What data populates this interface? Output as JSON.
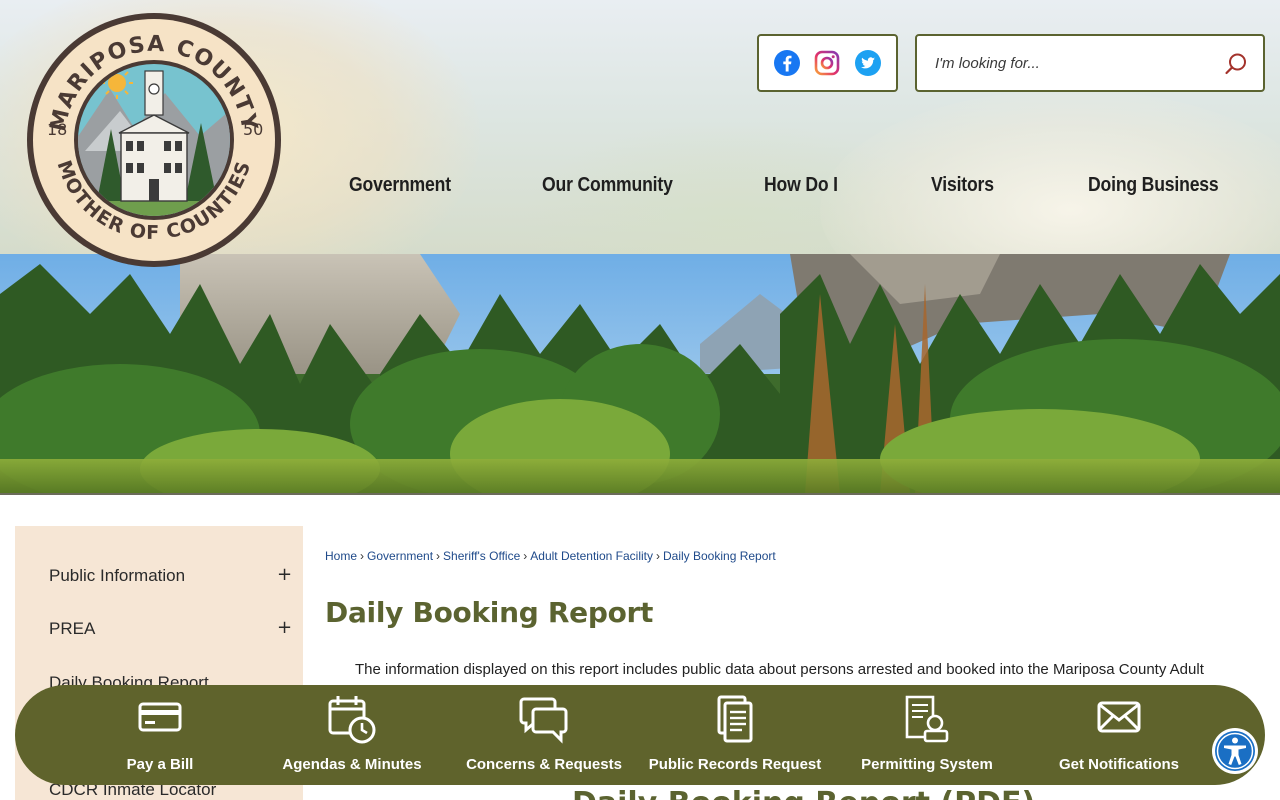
{
  "logo": {
    "text_top": "MARIPOSA COUNTY",
    "text_bottom": "MOTHER OF COUNTIES",
    "year_left": "18",
    "year_right": "50"
  },
  "social": {
    "icons": [
      "facebook-icon",
      "instagram-icon",
      "twitter-icon"
    ],
    "colors": {
      "facebook": "#1877f2",
      "twitter": "#1da1f2",
      "instagram": "#c13584"
    }
  },
  "search": {
    "placeholder": "I'm looking for...",
    "value": ""
  },
  "nav": {
    "items": [
      "Government",
      "Our Community",
      "How Do I",
      "Visitors",
      "Doing Business"
    ]
  },
  "sidebar": {
    "items": [
      {
        "label": "Public Information",
        "toggle": "+"
      },
      {
        "label": "PREA",
        "toggle": "+"
      },
      {
        "label": "Daily Booking Report",
        "toggle": ""
      },
      {
        "label": "CDCR Inmate Locator",
        "toggle": ""
      }
    ]
  },
  "breadcrumb": [
    "Home",
    "Government",
    "Sheriff's Office",
    "Adult Detention Facility",
    "Daily Booking Report"
  ],
  "breadcrumb_sep": "›",
  "main": {
    "title": "Daily Booking Report",
    "intro": "The information displayed on this report includes public data about persons arrested and booked into the Mariposa County Adult",
    "subheading": "Daily Booking Report (PDF)"
  },
  "quicklinks": [
    {
      "label": "Pay a Bill",
      "icon": "credit-card-icon"
    },
    {
      "label": "Agendas & Minutes",
      "icon": "calendar-clock-icon"
    },
    {
      "label": "Concerns & Requests",
      "icon": "chat-bubbles-icon"
    },
    {
      "label": "Public Records Request",
      "icon": "documents-icon"
    },
    {
      "label": "Permitting System",
      "icon": "certificate-icon"
    },
    {
      "label": "Get Notifications",
      "icon": "envelope-icon"
    }
  ],
  "theme": {
    "olive": "#5b6330",
    "quickbar_bg": "#5f632c",
    "sidebar_bg": "#f6e6d5",
    "link": "#1f4a8a"
  },
  "accessibility": {
    "icon": "accessibility-icon",
    "color": "#1a6fc4"
  }
}
